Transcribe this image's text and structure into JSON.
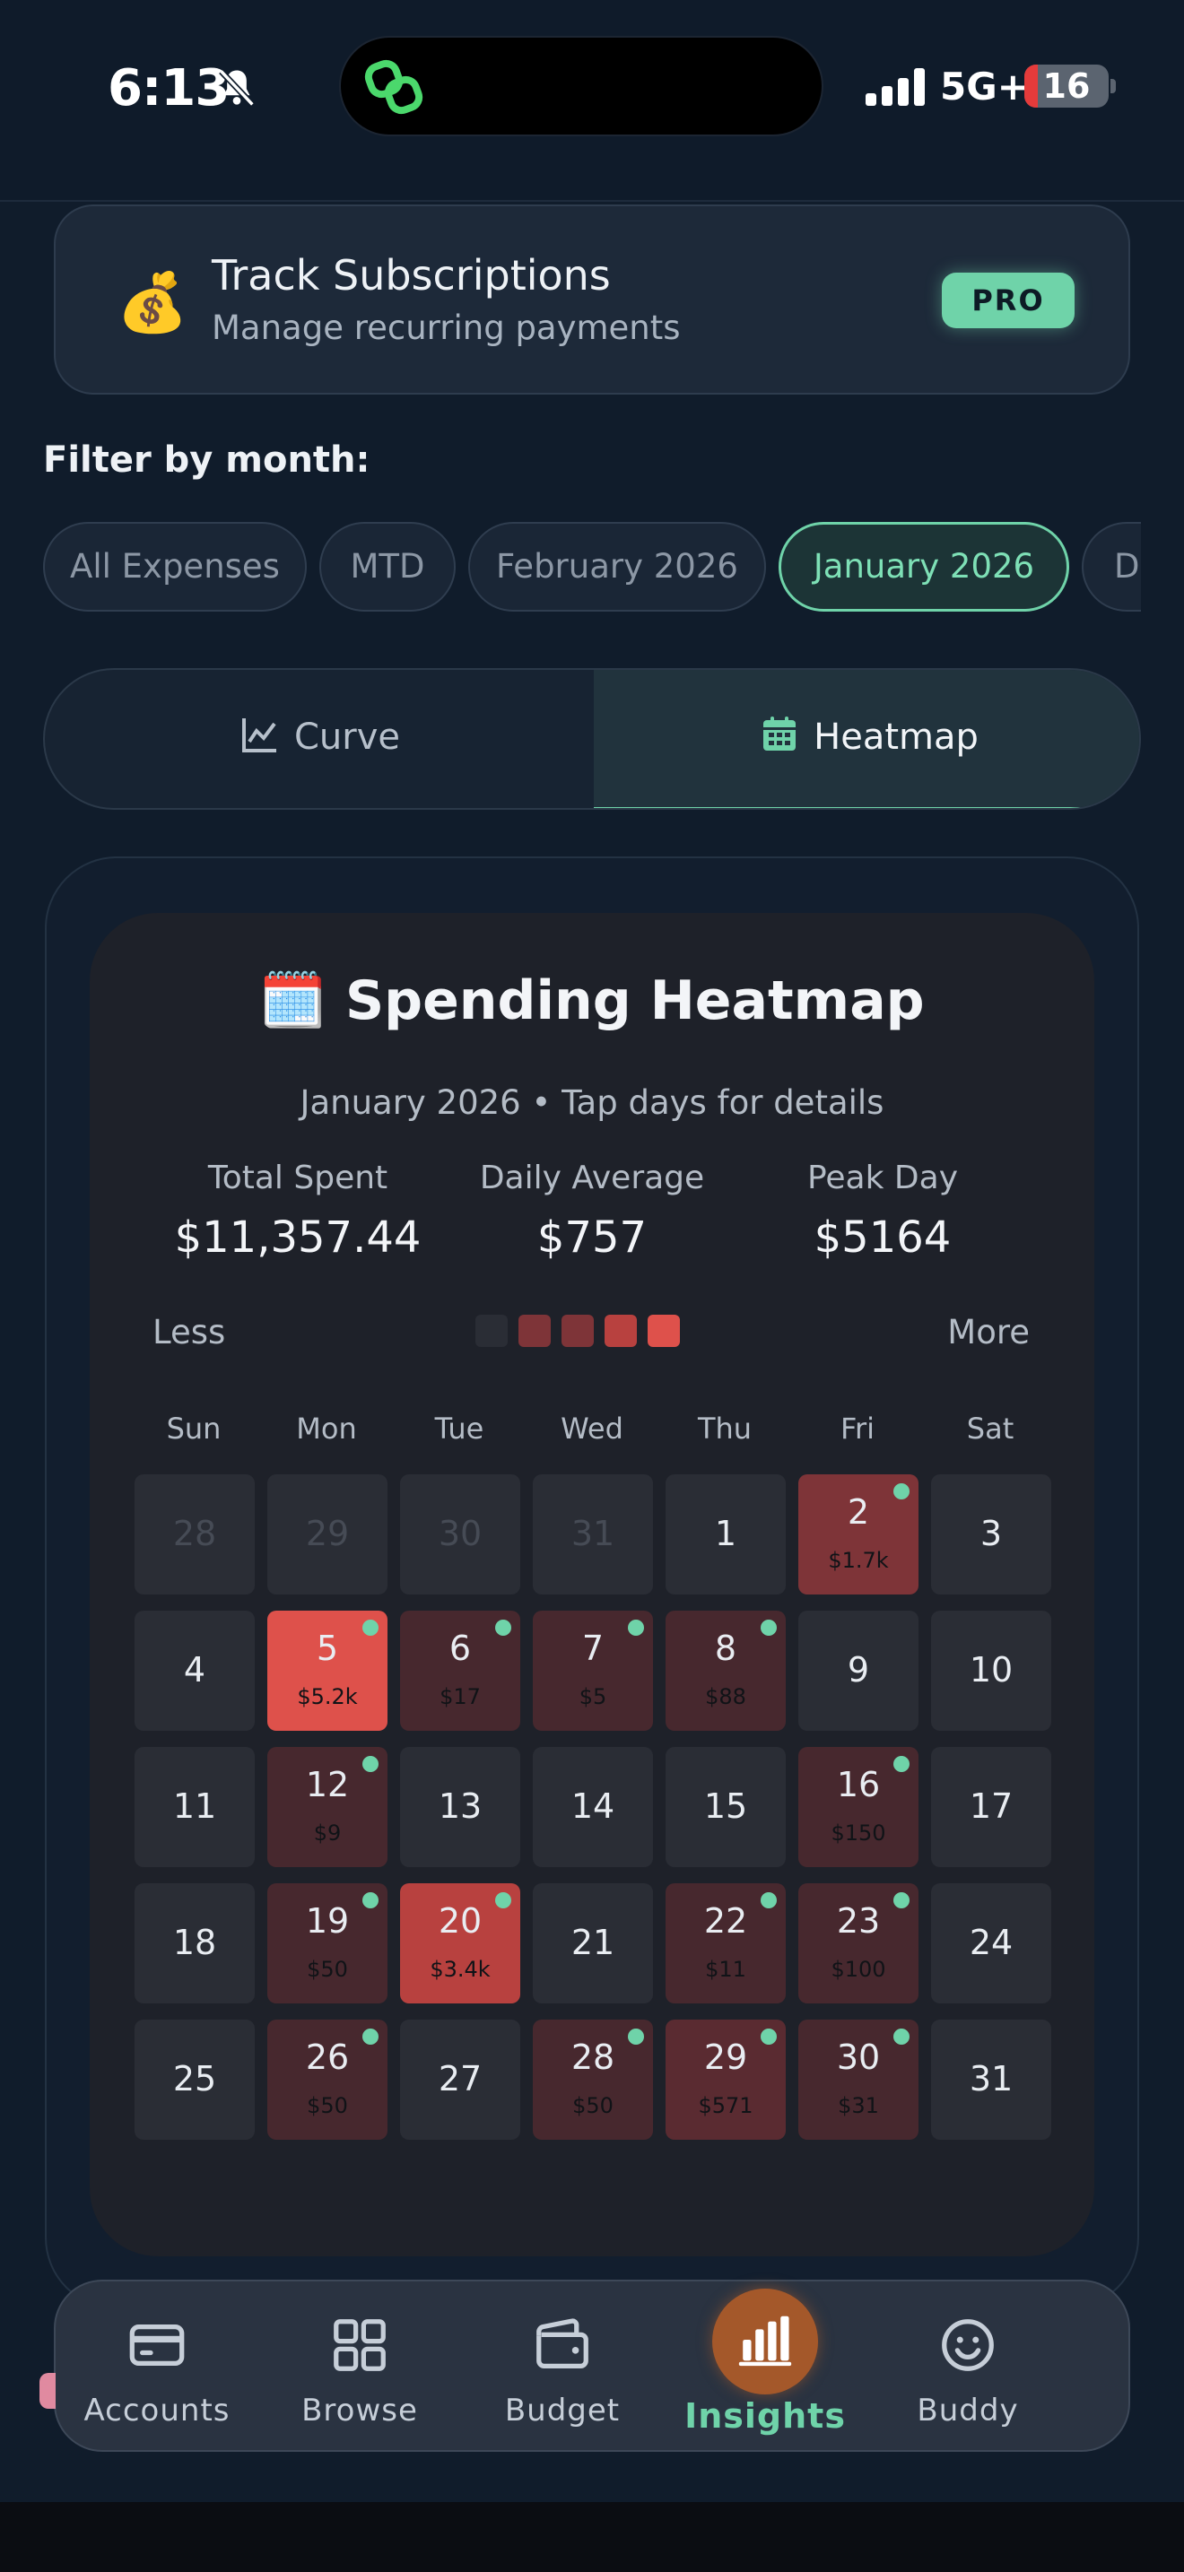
{
  "status_bar": {
    "time": "6:13",
    "network": "5G+",
    "battery": "16",
    "battery_fraction": 0.16
  },
  "promo": {
    "emoji": "💰",
    "title": "Track Subscriptions",
    "subtitle": "Manage recurring payments",
    "badge": "PRO"
  },
  "filter": {
    "label": "Filter by month:",
    "chips": [
      {
        "label": "All Expenses",
        "active": false
      },
      {
        "label": "MTD",
        "active": false
      },
      {
        "label": "February 2026",
        "active": false
      },
      {
        "label": "January 2026",
        "active": true
      },
      {
        "label": "De",
        "active": false
      }
    ]
  },
  "view_toggle": {
    "curve_label": "Curve",
    "heatmap_label": "Heatmap",
    "selected": "heatmap"
  },
  "heatmap": {
    "emoji": "🗓️",
    "title": "Spending Heatmap",
    "subtitle": "January 2026 • Tap days for details",
    "stats": [
      {
        "label": "Total Spent",
        "value": "$11,357.44"
      },
      {
        "label": "Daily Average",
        "value": "$757"
      },
      {
        "label": "Peak Day",
        "value": "$5164"
      }
    ],
    "legend": {
      "less": "Less",
      "more": "More"
    },
    "weekdays": [
      "Sun",
      "Mon",
      "Tue",
      "Wed",
      "Thu",
      "Fri",
      "Sat"
    ],
    "days": [
      {
        "day": "28",
        "muted": true
      },
      {
        "day": "29",
        "muted": true
      },
      {
        "day": "30",
        "muted": true
      },
      {
        "day": "31",
        "muted": true
      },
      {
        "day": "1"
      },
      {
        "day": "2",
        "amount": "$1.7k",
        "level": 2,
        "dot": true
      },
      {
        "day": "3"
      },
      {
        "day": "4"
      },
      {
        "day": "5",
        "amount": "$5.2k",
        "level": 4,
        "dot": true
      },
      {
        "day": "6",
        "amount": "$17",
        "level": 1,
        "dot": true
      },
      {
        "day": "7",
        "amount": "$5",
        "level": 1,
        "dot": true
      },
      {
        "day": "8",
        "amount": "$88",
        "level": 1,
        "dot": true
      },
      {
        "day": "9"
      },
      {
        "day": "10"
      },
      {
        "day": "11"
      },
      {
        "day": "12",
        "amount": "$9",
        "level": 1,
        "dot": true
      },
      {
        "day": "13"
      },
      {
        "day": "14"
      },
      {
        "day": "15"
      },
      {
        "day": "16",
        "amount": "$150",
        "level": 1,
        "dot": true
      },
      {
        "day": "17"
      },
      {
        "day": "18"
      },
      {
        "day": "19",
        "amount": "$50",
        "level": 1,
        "dot": true
      },
      {
        "day": "20",
        "amount": "$3.4k",
        "level": 3,
        "dot": true
      },
      {
        "day": "21"
      },
      {
        "day": "22",
        "amount": "$11",
        "level": 1,
        "dot": true
      },
      {
        "day": "23",
        "amount": "$100",
        "level": 1,
        "dot": true
      },
      {
        "day": "24"
      },
      {
        "day": "25"
      },
      {
        "day": "26",
        "amount": "$50",
        "level": 1,
        "dot": true
      },
      {
        "day": "27"
      },
      {
        "day": "28",
        "amount": "$50",
        "level": 1,
        "dot": true
      },
      {
        "day": "29",
        "amount": "$571",
        "level": 1.5,
        "dot": true
      },
      {
        "day": "30",
        "amount": "$31",
        "level": 1,
        "dot": true
      },
      {
        "day": "31"
      }
    ],
    "colors": {
      "empty": "#2a2d35",
      "level1": "#47282e",
      "level1_5": "#5a2b31",
      "level2": "#7e3438",
      "level3": "#b8413f",
      "level4": "#de514b",
      "dot": "#6fd3a9"
    }
  },
  "nav": {
    "items": [
      {
        "label": "Accounts",
        "icon": "card-icon"
      },
      {
        "label": "Browse",
        "icon": "grid-icon"
      },
      {
        "label": "Budget",
        "icon": "wallet-icon"
      },
      {
        "label": "Insights",
        "icon": "bar-chart-icon",
        "active": true
      },
      {
        "label": "Buddy",
        "icon": "smiley-icon"
      }
    ]
  },
  "theme": {
    "accent": "#6fd3a9",
    "background": "#101c2b"
  }
}
